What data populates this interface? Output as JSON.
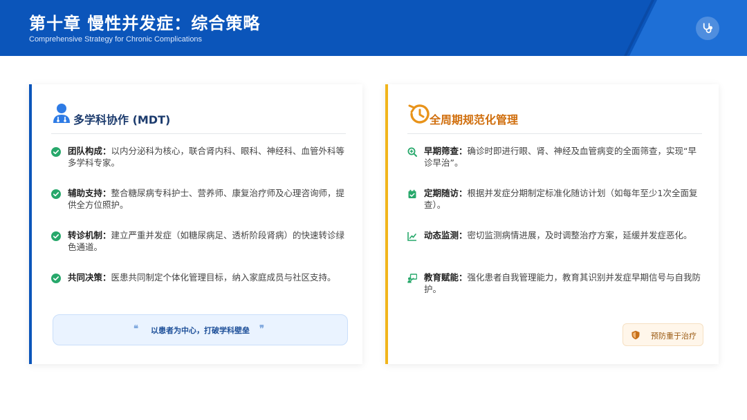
{
  "header": {
    "title": "第十章 慢性并发症：综合策略",
    "subtitle": "Comprehensive Strategy for Chronic Complications",
    "icon": "stethoscope-icon"
  },
  "colors": {
    "header_bg": "#0b55ba",
    "left_accent": "#0b55ba",
    "right_accent": "#f1b51c",
    "check_green": "#27a86b",
    "right_icon_green": "#27a86b",
    "right_title": "#d06e0c"
  },
  "left_card": {
    "title": "多学科协作 (MDT)",
    "icon": "doctor-team-icon",
    "items": [
      {
        "label": "团队构成：",
        "text": "以内分泌科为核心，联合肾内科、眼科、神经科、血管外科等多学科专家。",
        "icon": "check-circle-icon"
      },
      {
        "label": "辅助支持：",
        "text": "整合糖尿病专科护士、营养师、康复治疗师及心理咨询师，提供全方位照护。",
        "icon": "check-circle-icon"
      },
      {
        "label": "转诊机制：",
        "text": "建立严重并发症（如糖尿病足、透析阶段肾病）的快速转诊绿色通道。",
        "icon": "check-circle-icon"
      },
      {
        "label": "共同决策：",
        "text": "医患共同制定个体化管理目标，纳入家庭成员与社区支持。",
        "icon": "check-circle-icon"
      }
    ],
    "quote": {
      "open": "❝",
      "text": "以患者为中心，打破学科壁垒",
      "close": "❞"
    }
  },
  "right_card": {
    "title": "全周期规范化管理",
    "icon": "history-clock-icon",
    "items": [
      {
        "label": "早期筛查：",
        "text": "确诊时即进行眼、肾、神经及血管病变的全面筛查，实现“早诊早治”。",
        "icon": "search-plus-icon"
      },
      {
        "label": "定期随访：",
        "text": "根据并发症分期制定标准化随访计划（如每年至少1次全面复查）。",
        "icon": "calendar-check-icon"
      },
      {
        "label": "动态监测：",
        "text": "密切监测病情进展，及时调整治疗方案，延缓并发症恶化。",
        "icon": "line-chart-icon"
      },
      {
        "label": "教育赋能：",
        "text": "强化患者自我管理能力，教育其识别并发症早期信号与自我防护。",
        "icon": "teacher-board-icon"
      }
    ],
    "badge": {
      "text": "预防重于治疗",
      "icon": "shield-icon"
    }
  }
}
